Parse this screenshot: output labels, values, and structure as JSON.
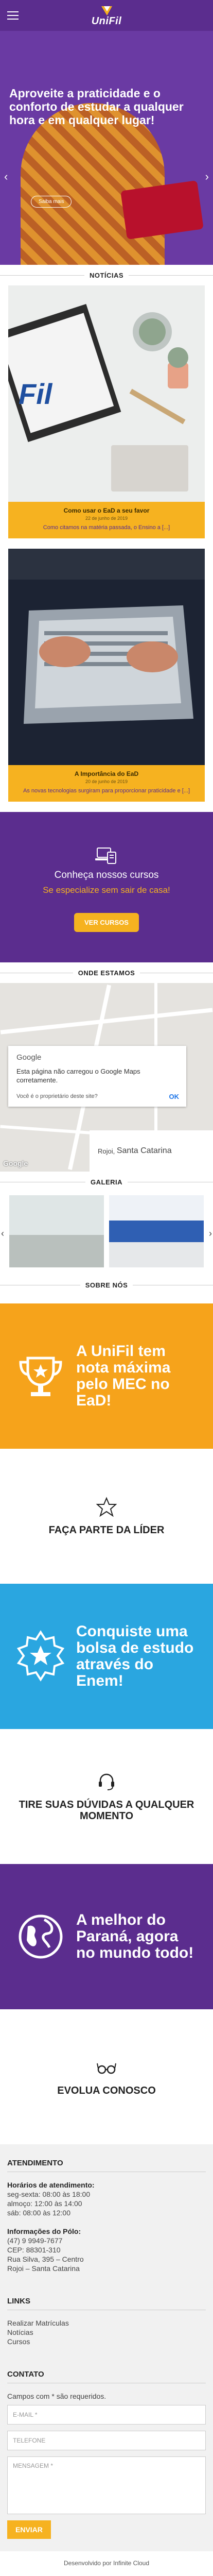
{
  "header": {
    "logo_text": "UniFil"
  },
  "hero": {
    "title": "Aproveite a praticidade e o conforto de estudar a qualquer hora e em qualquer lugar!",
    "button": "Saiba mais"
  },
  "news": {
    "heading": "NOTÍCIAS",
    "items": [
      {
        "title": "Como usar o EaD a seu favor",
        "date": "22 de junho de 2019",
        "excerpt": "Como citamos na matéria passada, o Ensino a [...]"
      },
      {
        "title": "A Importância do EaD",
        "date": "20 de junho de 2019",
        "excerpt": "As novas tecnologias surgiram para proporcionar praticidade e [...]"
      }
    ]
  },
  "courses": {
    "title": "Conheça nossos cursos",
    "subtitle": "Se especialize sem sair de casa!",
    "button": "VER CURSOS"
  },
  "map": {
    "heading": "ONDE ESTAMOS",
    "dialog_brand": "Google",
    "dialog_message": "Esta página não carregou o Google Maps corretamente.",
    "dialog_owner": "Você é o proprietário deste site?",
    "dialog_ok": "OK",
    "google_logo": "Google",
    "place": "Rojoi",
    "city": "Santa Catarina"
  },
  "gallery": {
    "heading": "GALERIA"
  },
  "about": {
    "heading": "SOBRE NÓS",
    "block1": "A UniFil tem nota máxima pelo MEC no EaD!",
    "block2": "FAÇA PARTE DA LÍDER",
    "block3": "Conquiste uma bolsa de estudo através do Enem!",
    "block4": "TIRE SUAS DÚVIDAS A QUALQUER MOMENTO",
    "block5": "A melhor do Paraná, agora no mundo todo!",
    "block6": "EVOLUA CONOSCO"
  },
  "footer": {
    "atendimento_head": "ATENDIMENTO",
    "hours_head": "Horários de atendimento:",
    "hours": [
      "seg-sexta: 08:00 às 18:00",
      "almoço: 12:00 às 14:00",
      "sáb: 08:00 às 12:00"
    ],
    "info_head": "Informações do Pólo:",
    "info": [
      "(47) 9 9949-7677",
      "CEP: 88301-310",
      "Rua Silva, 395 – Centro",
      "Rojoi – Santa Catarina"
    ],
    "links_head": "LINKS",
    "links": [
      "Realizar Matrículas",
      "Notícias",
      "Cursos"
    ],
    "contact_head": "CONTATO",
    "required_note": "Campos com * são requeridos.",
    "email_placeholder": "E-MAIL *",
    "phone_placeholder": "TELEFONE",
    "message_placeholder": "MENSAGEM *",
    "submit": "ENVIAR",
    "credit": "Desenvolvido por Infinite Cloud"
  },
  "colors": {
    "purple": "#5b2d8e",
    "yellow": "#f6b220",
    "orange": "#f6a31b",
    "blue": "#2aa6e0"
  }
}
